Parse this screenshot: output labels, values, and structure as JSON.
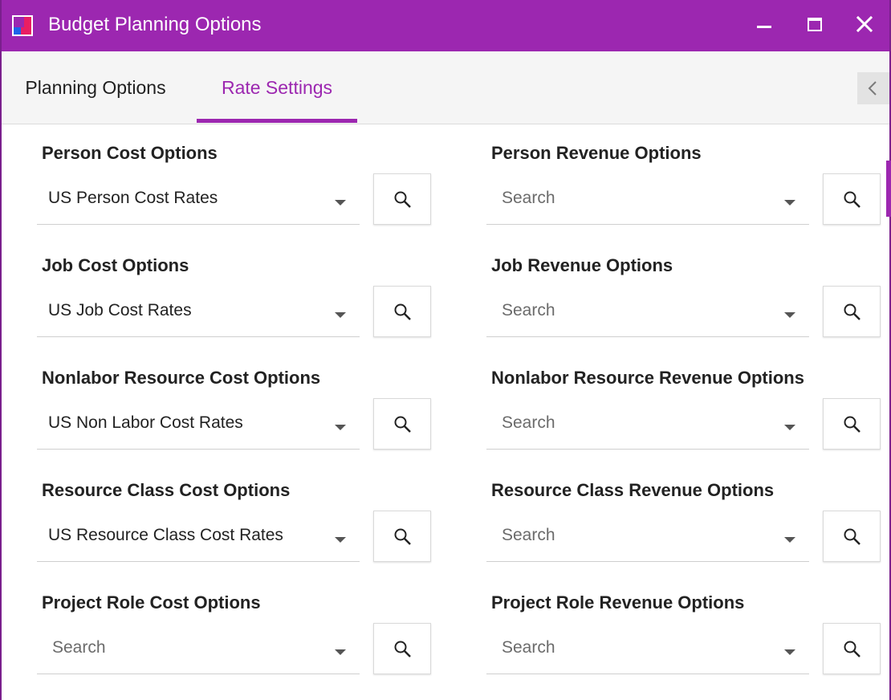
{
  "window": {
    "title": "Budget Planning Options",
    "accent_color": "#9c27b0",
    "icons": [
      "app-logo-icon",
      "minimize-icon",
      "maximize-icon",
      "close-icon"
    ]
  },
  "tabs": {
    "items": [
      {
        "label": "Planning Options",
        "active": false
      },
      {
        "label": "Rate Settings",
        "active": true
      }
    ],
    "scroll_icon": "chevron-left-icon"
  },
  "cost_options": [
    {
      "label": "Person Cost Options",
      "value": "US Person Cost Rates",
      "placeholder": "Search"
    },
    {
      "label": "Job Cost Options",
      "value": "US Job Cost Rates",
      "placeholder": "Search"
    },
    {
      "label": "Nonlabor Resource Cost Options",
      "value": "US Non Labor Cost Rates",
      "placeholder": "Search"
    },
    {
      "label": "Resource Class Cost Options",
      "value": "US Resource Class Cost Rates",
      "placeholder": "Search"
    },
    {
      "label": "Project Role Cost Options",
      "value": "",
      "placeholder": "Search"
    }
  ],
  "revenue_options": [
    {
      "label": "Person Revenue Options",
      "value": "",
      "placeholder": "Search"
    },
    {
      "label": "Job Revenue Options",
      "value": "",
      "placeholder": "Search"
    },
    {
      "label": "Nonlabor Resource Revenue Options",
      "value": "",
      "placeholder": "Search"
    },
    {
      "label": "Resource Class Revenue Options",
      "value": "",
      "placeholder": "Search"
    },
    {
      "label": "Project Role Revenue Options",
      "value": "",
      "placeholder": "Search"
    }
  ]
}
